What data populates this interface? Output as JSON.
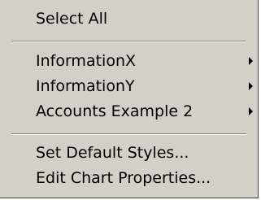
{
  "context_menu": {
    "items": [
      {
        "label": "Select All"
      },
      {
        "label": "InformationX",
        "submenu": true
      },
      {
        "label": "InformationY",
        "submenu": true
      },
      {
        "label": "Accounts Example 2",
        "submenu": true
      },
      {
        "label": "Set Default Styles..."
      },
      {
        "label": "Edit Chart Properties..."
      }
    ]
  }
}
